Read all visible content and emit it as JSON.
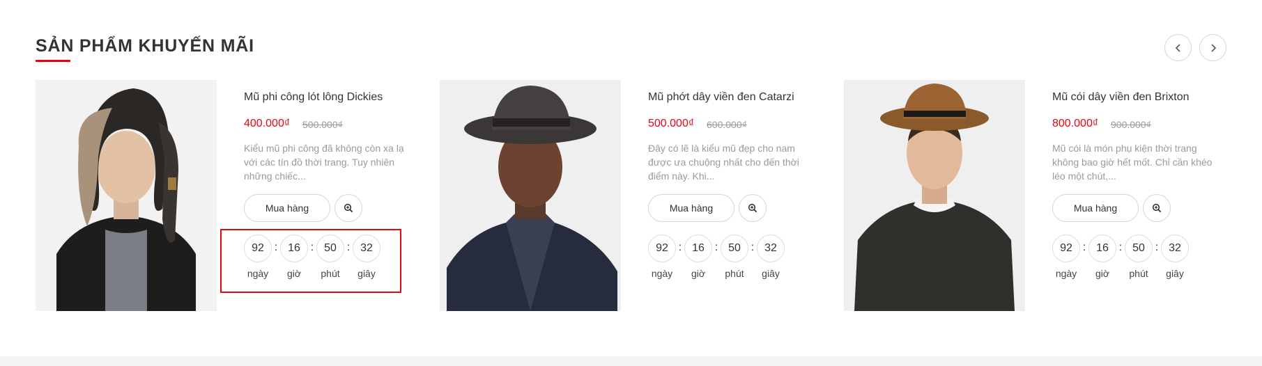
{
  "section": {
    "title": "SẢN PHẨM KHUYẾN MÃI"
  },
  "nav": {
    "prev_icon": "chevron-left-icon",
    "next_icon": "chevron-right-icon"
  },
  "colors": {
    "accent": "#e30613",
    "muted": "#9a9a9a",
    "text": "#333333"
  },
  "countdown_labels": {
    "days": "ngày",
    "hours": "giờ",
    "minutes": "phút",
    "seconds": "giây"
  },
  "products": [
    {
      "name": "Mũ phi công lót lông Dickies",
      "price": "400.000₫",
      "old_price": "500.000₫",
      "desc": "Kiểu mũ phi công đã không còn xa lạ với các tín đồ thời trang. Tuy nhiên những chiếc...",
      "buy_label": "Mua hàng",
      "countdown": {
        "days": "92",
        "hours": "16",
        "minutes": "50",
        "seconds": "32"
      }
    },
    {
      "name": "Mũ phớt dây viền đen Catarzi",
      "price": "500.000₫",
      "old_price": "600.000₫",
      "desc": "Đây có lẽ là kiểu mũ đẹp cho nam được ưa chuộng nhất cho đến thời điểm này. Khi...",
      "buy_label": "Mua hàng",
      "countdown": {
        "days": "92",
        "hours": "16",
        "minutes": "50",
        "seconds": "32"
      }
    },
    {
      "name": "Mũ cói dây viền đen Brixton",
      "price": "800.000₫",
      "old_price": "900.000₫",
      "desc": "Mũ cói là món phụ kiện thời trang không bao giờ hết mốt. Chỉ cần khéo léo một chút,...",
      "buy_label": "Mua hàng",
      "countdown": {
        "days": "92",
        "hours": "16",
        "minutes": "50",
        "seconds": "32"
      }
    }
  ]
}
